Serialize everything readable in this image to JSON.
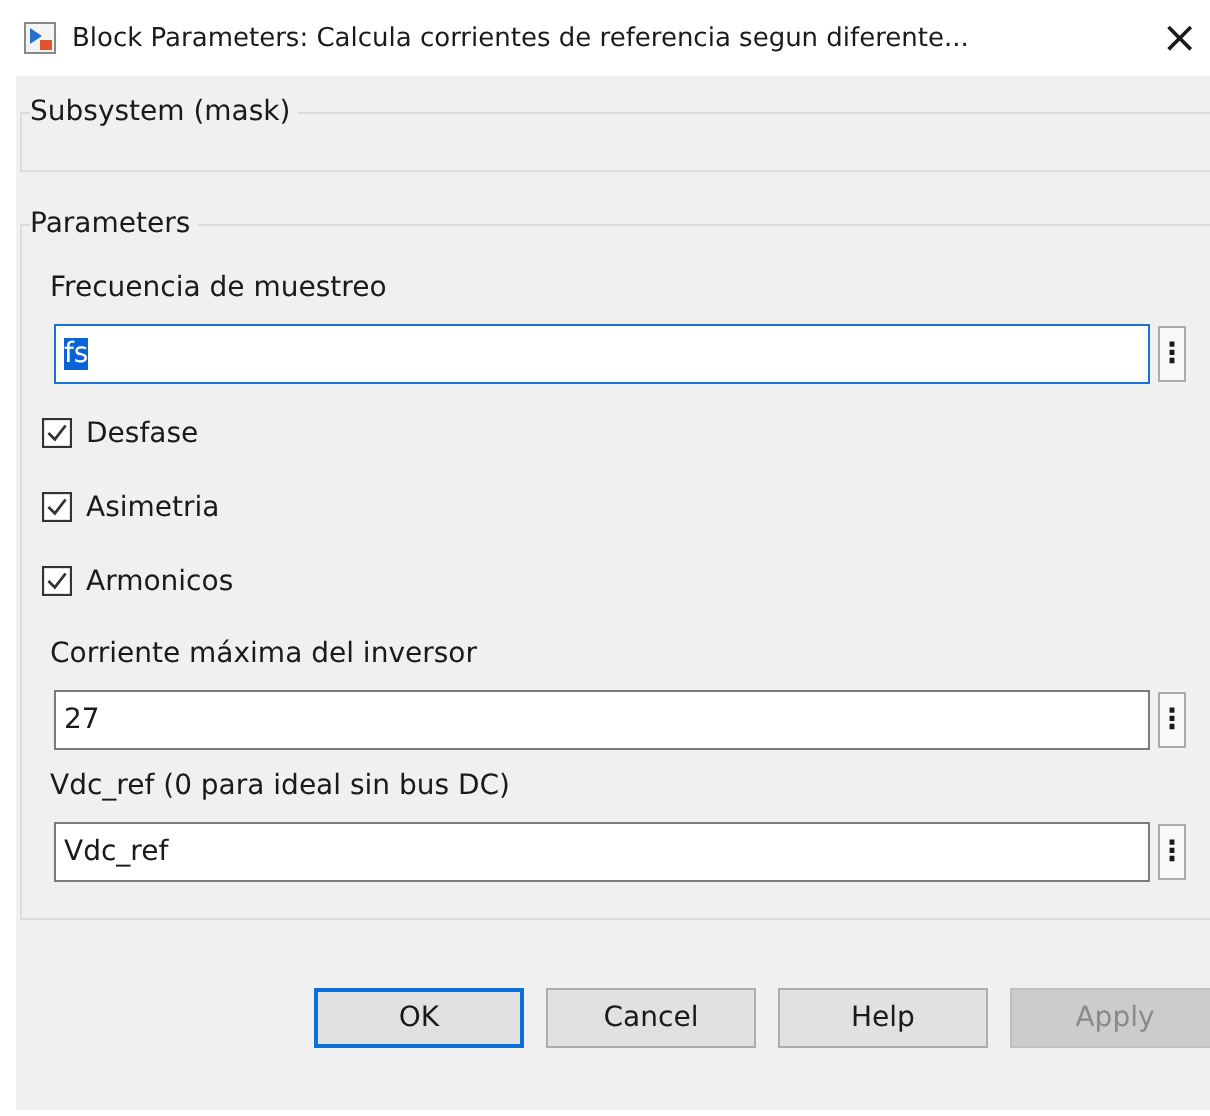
{
  "window": {
    "title": "Block Parameters: Calcula corrientes de referencia segun diferente...",
    "close": "×"
  },
  "mask_group": {
    "title": "Subsystem (mask)"
  },
  "parameters_group": {
    "title": "Parameters",
    "items": [
      {
        "kind": "edit",
        "label": "Frecuencia de muestreo",
        "value": "fs",
        "focused": true,
        "more": "⋮"
      },
      {
        "kind": "checkbox",
        "label": "Desfase",
        "checked": true
      },
      {
        "kind": "checkbox",
        "label": "Asimetria",
        "checked": true
      },
      {
        "kind": "checkbox",
        "label": "Armonicos",
        "checked": true
      },
      {
        "kind": "edit",
        "label": "Corriente máxima del inversor",
        "value": "27",
        "focused": false,
        "more": "⋮"
      },
      {
        "kind": "edit",
        "label": "Vdc_ref (0 para ideal sin bus DC)",
        "value": "Vdc_ref",
        "focused": false,
        "more": "⋮"
      }
    ]
  },
  "buttons": [
    {
      "label": "OK",
      "default": true,
      "disabled": false
    },
    {
      "label": "Cancel",
      "default": false,
      "disabled": false
    },
    {
      "label": "Help",
      "default": false,
      "disabled": false
    },
    {
      "label": "Apply",
      "default": false,
      "disabled": true
    }
  ]
}
